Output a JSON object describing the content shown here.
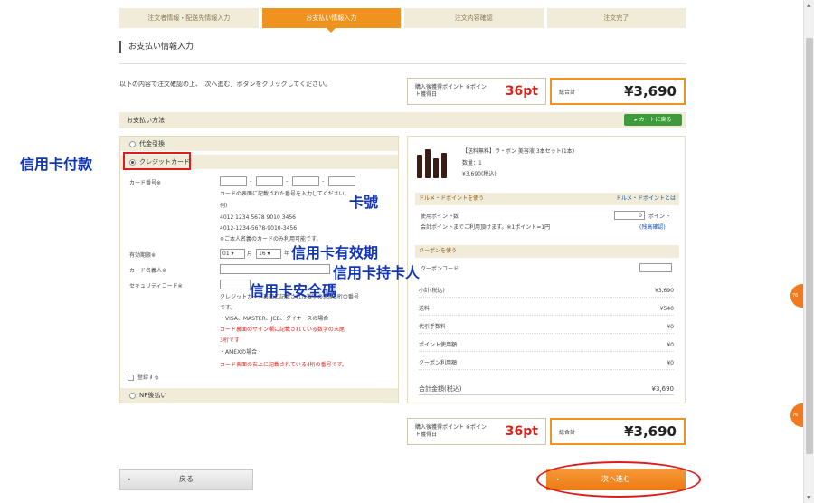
{
  "steps": [
    "注文者情報・配送先情報入力",
    "お支払い情報入力",
    "注文内容確認",
    "注文完了"
  ],
  "page_title": "お支払い情報入力",
  "intro_text": "以下の内容で注文確認の上、「次へ進む」ボタンをクリックしてください。",
  "points_box": {
    "label": "購入後獲得ポイント ※ポイント獲得日",
    "value": "36pt"
  },
  "total_box": {
    "label": "総合計",
    "value": "¥3,690"
  },
  "section_label": "お支払い方法",
  "cart_button": "カートに戻る",
  "payment_options": {
    "opt1": "代金引換",
    "opt2": "クレジットカード",
    "opt3": "NP後払い"
  },
  "form": {
    "card_number_label": "カード番号※",
    "card_note1": "カードの表面に記載された番号を入力してください。",
    "card_example_label": "例)",
    "card_example1": "4012 1234 5678 9010 3456",
    "card_example2": "4012-1234-5678-9010-3456",
    "card_note2": "※ご本人名義のカードのみ利用可能です。",
    "expiry_label": "有効期限※",
    "expiry_month": "01",
    "expiry_month_unit": "月",
    "expiry_year": "16",
    "expiry_year_unit": "年",
    "holder_label": "カード名義人※",
    "cvv_label": "セキュリティコード※",
    "cvv_note1": "クレジットカード裏面に記載された数字の末尾3桁の番号",
    "cvv_note2": "です。",
    "cvv_visa": "・VISA、MASTER、JCB、ダイナースの場合",
    "cvv_visa_red": "カード裏面のサイン欄に記載されている数字の末尾",
    "cvv_visa_red2": "3桁です",
    "cvv_amex": "・AMEXの場合",
    "cvv_amex_red": "カード表面の右上に記載されている4桁の番号です。",
    "save_label": "登録する"
  },
  "product": {
    "name": "【送料無料】ラ・ボン 美容液 3本セット(1本)",
    "qty": "数量：1",
    "price": "¥3,690(税込)"
  },
  "points_section": {
    "head": "ドルメ・ドポイントを使う",
    "link": "ドルメ・ドポイントとは",
    "row1": "使用ポイント数",
    "row1_value": "0",
    "row1_unit": "ポイント",
    "row2": "会計ポイントまでご利用頂けます。※1ポイント=1円",
    "row2_link": "(残高確認)"
  },
  "coupon_section": {
    "head": "クーポンを使う",
    "row": "クーポンコード"
  },
  "summary": [
    {
      "label": "小計(税込)",
      "value": "¥3,690"
    },
    {
      "label": "送料",
      "value": "¥540"
    },
    {
      "label": "代引手数料",
      "value": "¥0"
    },
    {
      "label": "ポイント使用額",
      "value": "¥0"
    },
    {
      "label": "クーポン利用額",
      "value": "¥0"
    }
  ],
  "grand_total": {
    "label": "合計金額(税込)",
    "value": "¥3,690"
  },
  "back_button": "戻る",
  "next_button": "次へ進む",
  "annotations": {
    "credit": "信用卡付款",
    "card_no": "卡號",
    "expiry": "信用卡有效期",
    "holder": "信用卡持卡人",
    "cvv": "信用卡安全碼"
  },
  "floating_tab": "76",
  "colors": {
    "accent": "#f0921e",
    "annotation": "#1035b8",
    "highlight": "#e01b1b",
    "price_red": "#d9241b",
    "green": "#3e9b3c"
  }
}
